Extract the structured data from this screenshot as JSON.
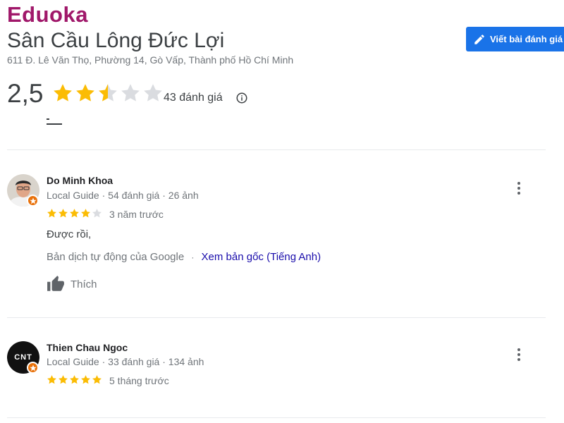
{
  "watermark": {
    "logo_text": "Eduoka"
  },
  "place": {
    "name": "Sân Cầu Lông Đức Lợi",
    "address": "611 Đ. Lê Văn Thọ, Phường 14, Gò Vấp, Thành phố Hồ Chí Minh",
    "rating": "2,5",
    "rating_value": 2.5,
    "max_rating": 5,
    "review_count": "43 đánh giá"
  },
  "actions": {
    "write_review_label": "Viết bài đánh giá"
  },
  "colors": {
    "star_filled": "#fbbc04",
    "star_empty": "#dadce0",
    "primary": "#1a73e8",
    "link": "#1a0dab",
    "badge": "#e8710a"
  },
  "reviews": [
    {
      "name": "Do Minh Khoa",
      "meta": "Local Guide · 54 đánh giá · 26 ảnh",
      "stars": 4,
      "time": "3 năm trước",
      "text": "Được rồi,",
      "translation_note": "Bản dịch tự động của Google",
      "separator": "·",
      "view_original": "Xem bản gốc (Tiếng Anh)",
      "like_label": "Thích"
    },
    {
      "name": "Thien Chau Ngoc",
      "avatar_text": "CNT",
      "meta": "Local Guide · 33 đánh giá · 134 ảnh",
      "stars": 5,
      "time": "5 tháng trước"
    }
  ]
}
